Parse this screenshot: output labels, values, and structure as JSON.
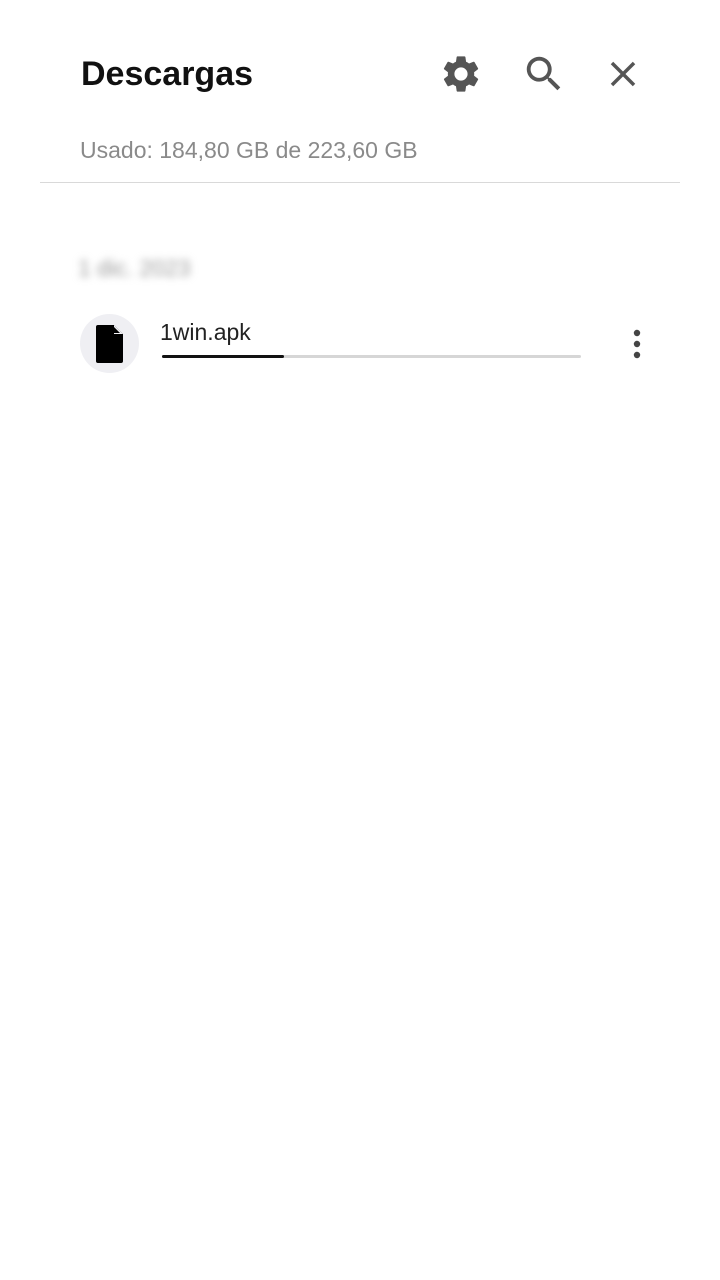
{
  "header": {
    "title": "Descargas",
    "settings_icon": "gear-icon",
    "search_icon": "search-icon",
    "close_icon": "close-icon"
  },
  "storage": {
    "text": "Usado: 184,80 GB de 223,60 GB"
  },
  "downloads": {
    "group_date": "1 dic. 2023",
    "items": [
      {
        "icon": "file-icon",
        "name": "1win.apk",
        "progress": 0.29,
        "menu_icon": "more-vert-icon"
      }
    ]
  },
  "colors": {
    "title": "#111111",
    "subtext": "#8a8a8a",
    "icon": "#555555",
    "progress_fill": "#111111",
    "progress_track": "#d6d6d6",
    "file_icon_bg": "#efeff3"
  }
}
